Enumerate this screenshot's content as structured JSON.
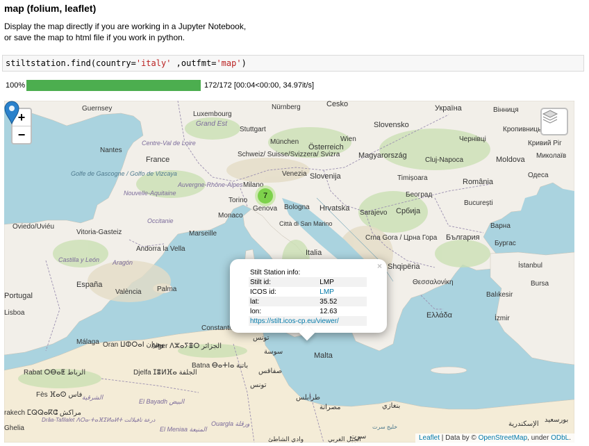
{
  "heading": "map (folium, leaflet)",
  "description": {
    "line1": "Display the map directly if you are working in a Jupyter Notebook,",
    "line2": "or save the map to html file if you work in python."
  },
  "code": {
    "prefix": "stiltstation.find(country=",
    "arg1": "'italy'",
    "middle": " ,outfmt=",
    "arg2": "'map'",
    "suffix": ")"
  },
  "progress": {
    "percent_label": "100%",
    "fraction": 1.0,
    "stats": "172/172 [00:04<00:00, 34.97it/s]"
  },
  "map": {
    "zoom_in": "+",
    "zoom_out": "−",
    "layers_icon": "layers-icon",
    "cluster_count": "7",
    "colors": {
      "sea": "#aad3df",
      "land": "#f2efe9",
      "cluster": "#6ecc39",
      "marker": "#2a81cb",
      "border": "#9b8fb0"
    },
    "labels": {
      "guernsey": "Guernsey",
      "luxembourg": "Luxembourg",
      "nurnberg": "Nürnberg",
      "cesko": "Česko",
      "ukraine": "Україна",
      "vinnytsia": "Вінниця",
      "grand_est": "Grand Est",
      "stuttgart": "Stuttgart",
      "munchen": "München",
      "wien": "Wien",
      "slovensko": "Slovensko",
      "kropyvnytskyi": "Кропивницький",
      "chernivtsi": "Чернівці",
      "kryvyi_rih": "Кривий Ріг",
      "nantes": "Nantes",
      "centre": "Centre-Val de Loire",
      "schweiz": "Schweiz/ Suisse/Svizzera/ Svizra",
      "osterreich": "Österreich",
      "magyarorszag": "Magyarország",
      "cluj": "Cluj-Napoca",
      "moldova": "Moldova",
      "mykolaiv": "Миколаїв",
      "france": "France",
      "slovenija": "Slovenija",
      "hrvatska": "Hrvatska",
      "timisoara": "Timișoara",
      "romania": "România",
      "odesa": "Одеса",
      "golfe": "Golfe de Gascogne / Golfo de Vizcaya",
      "nouvelle": "Nouvelle-Aquitaine",
      "auvergne": "Auvergne-Rhône-Alpes",
      "milano": "Milano",
      "venezia": "Venezia",
      "torino": "Torino",
      "genova": "Genova",
      "bologna": "Bologna",
      "beograd": "Београд",
      "sarajevo": "Sarajevo",
      "srbija": "Србија",
      "bucuresti": "București",
      "monaco": "Monaco",
      "occitanie": "Occitanie",
      "citta": "Città di San Marino",
      "oviedo": "Oviedo/Uviéu",
      "vitoria": "Vitoria-Gasteiz",
      "marseille": "Marseille",
      "varna": "Варна",
      "crna_gora": "Crna Gora / Црна Гора",
      "bulgaria": "България",
      "burgas": "Бургас",
      "andorra": "Andorra la Vella",
      "castilla": "Castilla y León",
      "aragon": "Aragón",
      "italia": "Italia",
      "istanbul": "İstanbul",
      "shqiperia": "Shqipëria",
      "espana": "España",
      "thessaloniki": "Θεσσαλονίκη",
      "palma": "Palma",
      "valencia": "València",
      "portugal": "Portugal",
      "balikesir": "Balıkesir",
      "bursa": "Bursa",
      "elladha": "Ελλάδα",
      "izmir": "İzmir",
      "lisboa": "Lisboa",
      "constantine": "Constantine قسنطينة",
      "malaga": "Málaga",
      "oran": "Oran ⵡⵀⵔⴰⵏ وهران",
      "alger": "Alger ⴷⵣⴰⵢⴻⵔ الجزائر",
      "tunis": "تونس",
      "sousse": "سوسة",
      "sfax": "صفاقس",
      "malta": "Malta",
      "rabat": "Rabat ⵔⴱⴰⵟ الرباط",
      "batna": "Batna ⴱⴰⵜⵏⴰ باتنة",
      "djelfa": "Djelfa ⵊⴻⵍⴼⴰ الجلفة",
      "tounes": "تونس",
      "fes": "Fès ⴼⴰⵙ فاس",
      "charqia": "الشرقية",
      "tripoli": "طرابلس",
      "misrata": "مصراتة",
      "benghazi": "بنغازي",
      "iskandaria": "الإسكندرية",
      "bursaid": "بورسعيد",
      "el_bayadh": "El Bayadh البيض",
      "draa": "Drâa-Tafilalet ⴷⵔⴰ-ⵜⴰⴼⵉⵍⴰⵍⵜ درعة تافيلالت",
      "el_meniaa": "El Meniaa المنيعة",
      "ouargla": "Ouargla ورقلة",
      "wadi_shati": "وادي الشاطئ",
      "al_jabal": "الجبل الغربي",
      "surt": "سرت",
      "rakech": "rakech ⵎⵕⵕⴰⴽⵛ مراكش",
      "ghelia": "Ghelia",
      "khalij_surt": "خليج سرت"
    },
    "popup": {
      "close": "×",
      "title": "Stilt Station info:",
      "rows": [
        {
          "key": "Stilt id:",
          "value": "LMP"
        },
        {
          "key": "ICOS id:",
          "value": "LMP"
        },
        {
          "key": "lat:",
          "value": "35.52"
        },
        {
          "key": "lon:",
          "value": "12.63"
        }
      ],
      "link": "https://stilt.icos-cp.eu/viewer/"
    },
    "attribution": {
      "leaflet": "Leaflet",
      "data_by": " | Data by © ",
      "osm": "OpenStreetMap",
      "under": ", under ",
      "odbl": "ODbL",
      "end": "."
    }
  }
}
